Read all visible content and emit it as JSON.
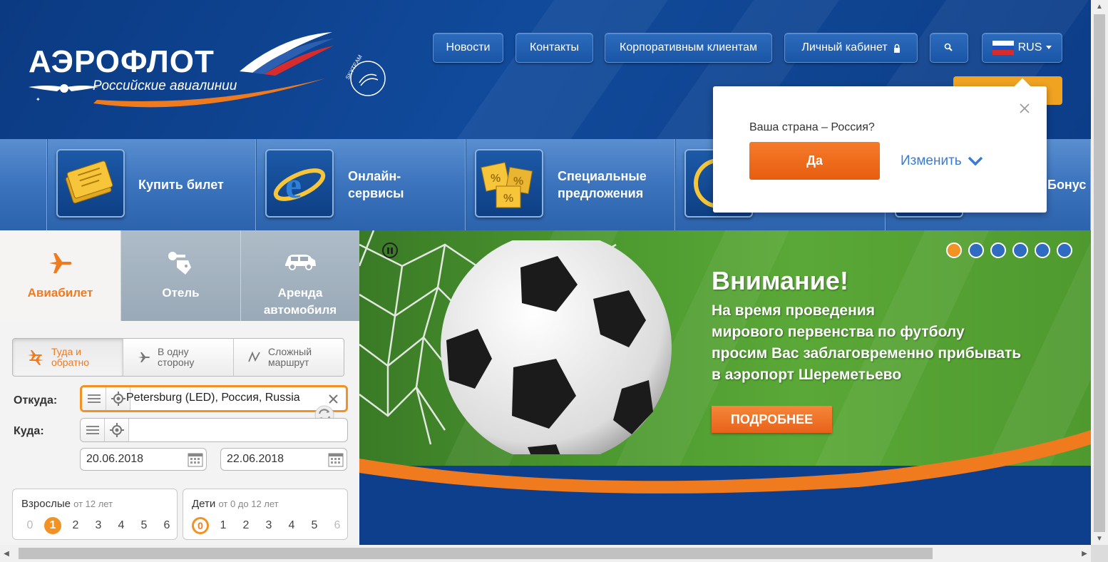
{
  "header": {
    "logo_text": "АЭРОФЛОТ",
    "logo_subtitle": "Российские авиалинии",
    "alliance": "SKYTEAM",
    "nav": [
      {
        "label": "Новости"
      },
      {
        "label": "Контакты"
      },
      {
        "label": "Корпоративным клиентам"
      },
      {
        "label": "Личный кабинет"
      }
    ],
    "search_icon": "search-icon",
    "language": "RUS",
    "colors": {
      "brand_blue": "#114a9b",
      "accent_orange": "#f07a1e"
    }
  },
  "categories": [
    {
      "label": "Купить билет",
      "icon": "tickets-icon"
    },
    {
      "label": "Онлайн-\nсервисы",
      "icon": "ie-globe-icon"
    },
    {
      "label": "Специальные\nпредложения",
      "icon": "discount-cubes-icon"
    },
    {
      "label": "Бонус",
      "icon": "bonus-icon"
    }
  ],
  "popup": {
    "question": "Ваша страна – Россия?",
    "yes": "Да",
    "change": "Изменить"
  },
  "booking": {
    "tabs": [
      {
        "label": "Авиабилет",
        "active": true
      },
      {
        "label": "Отель",
        "active": false
      },
      {
        "label": "Аренда автомобиля",
        "active": false
      }
    ],
    "trip_types": [
      {
        "label": "Туда и обратно",
        "active": true
      },
      {
        "label": "В одну сторону",
        "active": false
      },
      {
        "label": "Сложный маршрут",
        "active": false
      }
    ],
    "from_label": "Откуда:",
    "from_value": "Petersburg (LED), Россия, Russia",
    "to_label": "Куда:",
    "to_value": "",
    "date_out": "20.06.2018",
    "date_back": "22.06.2018",
    "adults": {
      "title": "Взрослые",
      "hint": "от 12 лет",
      "options": [
        "0",
        "1",
        "2",
        "3",
        "4",
        "5",
        "6"
      ],
      "selected": "1"
    },
    "children": {
      "title": "Дети",
      "hint": "от 0 до 12 лет",
      "options": [
        "0",
        "1",
        "2",
        "3",
        "4",
        "5",
        "6"
      ],
      "selected": "0"
    }
  },
  "banner": {
    "title": "Внимание!",
    "lines": [
      "На время проведения",
      "мирового первенства по футболу",
      "просим Вас заблаговременно прибывать",
      "в аэропорт Шереметьево"
    ],
    "button": "ПОДРОБНЕЕ",
    "slides": 6,
    "active_slide": 1
  }
}
